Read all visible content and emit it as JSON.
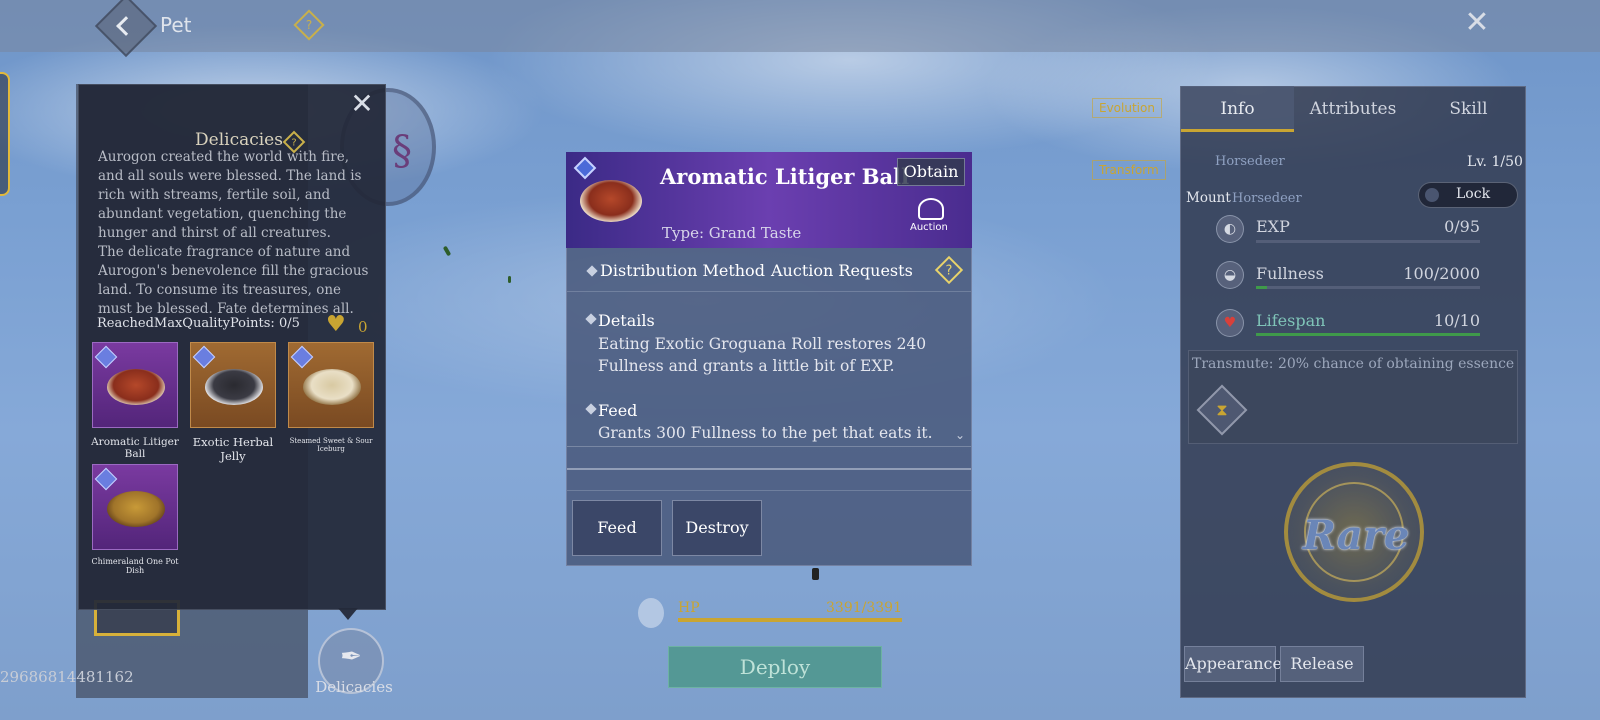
{
  "top_bar": {
    "title": "Pet",
    "help_glyph": "?",
    "close_glyph": "✕"
  },
  "background_panel": {
    "user_id": "29686814481162",
    "delicacies_button_label": "Delicacies"
  },
  "delicacies_popup": {
    "title": "Delicacies",
    "help_glyph": "?",
    "close_glyph": "✕",
    "lore": "Aurogon created the world with fire, and all souls were blessed. The land is rich with streams, fertile soil, and abundant vegetation, quenching the hunger and thirst of all creatures.\nThe delicate fragrance of nature and Aurogon's benevolence fill the gracious land. To consume its treasures, one must be blessed. Fate determines all.",
    "quality_points": "ReachedMaxQualityPoints: 0/5",
    "heart_count": "0",
    "items": [
      {
        "label": "Aromatic Litiger Ball",
        "rarity": "purple",
        "dish_color": "#b5482a"
      },
      {
        "label": "Exotic Herbal Jelly",
        "rarity": "orange",
        "dish_color": "#2a2a30"
      },
      {
        "label": "Steamed Sweet & Sour Iceburg",
        "rarity": "orange",
        "dish_color": "#e9dfc6"
      },
      {
        "label": "Chimeraland One Pot Dish",
        "rarity": "purple",
        "dish_color": "#c89a38"
      }
    ]
  },
  "item_detail": {
    "name": "Aromatic Litiger Ball",
    "type": "Type: Grand Taste",
    "obtain_label": "Obtain",
    "auction_label": "Auction",
    "distribution_method": "Distribution Method",
    "auction_requests": "Auction Requests",
    "help_glyph": "?",
    "details_title": "Details",
    "details_text": "Eating Exotic Groguana Roll restores 240 Fullness and grants a little bit of EXP.",
    "feed_title": "Feed",
    "feed_text": "Grants 300 Fullness to the pet that eats it.",
    "scroll_glyph": "⌄",
    "feed_button": "Feed",
    "destroy_button": "Destroy"
  },
  "hp": {
    "label": "HP",
    "value": "3391/3391",
    "fill_fraction": 1.0
  },
  "deploy_label": "Deploy",
  "side_buttons": {
    "evolution": "Evolution",
    "transform": "Transform"
  },
  "info_panel": {
    "tabs": [
      "Info",
      "Attributes",
      "Skill"
    ],
    "active_tab": "Info",
    "pet_name": "Horsedeer",
    "level": "Lv. 1/50",
    "mount_label": "Mount",
    "mount_value": "Horsedeer",
    "lock_label": "Lock",
    "stats": [
      {
        "label": "EXP",
        "value": "0/95",
        "fill_fraction": 0.0,
        "color": "#5a6a8a",
        "label_color": "#d0d4de",
        "icon": "exp-icon",
        "glyph": "◐"
      },
      {
        "label": "Fullness",
        "value": "100/2000",
        "fill_fraction": 0.05,
        "color": "#3f9a4a",
        "label_color": "#d0d4de",
        "icon": "fullness-icon",
        "glyph": "◒"
      },
      {
        "label": "Lifespan",
        "value": "10/10",
        "fill_fraction": 1.0,
        "color": "#3f9a4a",
        "label_color": "#7fc4b8",
        "icon": "lifespan-heart-icon",
        "glyph": "♥"
      }
    ],
    "transmute_text": "Transmute: 20% chance of obtaining essence",
    "essence_glyph": "⧗",
    "rarity": "Rare",
    "appearance_button": "Appearance",
    "release_button": "Release"
  },
  "colors": {
    "accent_gold": "#c9a532",
    "item_header_purple": "#6b3fb0",
    "deploy_green": "#46967f"
  }
}
